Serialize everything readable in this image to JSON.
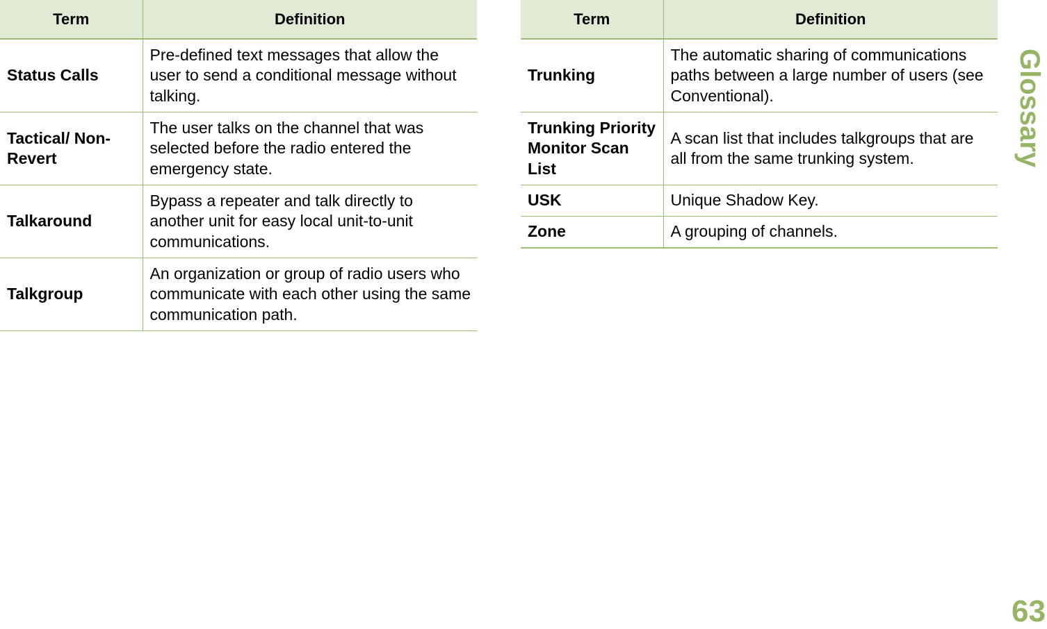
{
  "section_title": "Glossary",
  "page_number": "63",
  "accent_color": "#95b565",
  "header_bg_color": "#e1ead5",
  "tables": [
    {
      "headers": {
        "term": "Term",
        "definition": "Definition"
      },
      "rows": [
        {
          "term": "Status Calls",
          "definition": "Pre-defined text messages that allow the user to send a conditional message without talking."
        },
        {
          "term": "Tactical/ Non-Revert",
          "definition": "The user talks on the channel that was selected before the radio entered the emergency state."
        },
        {
          "term": "Talkaround",
          "definition": "Bypass a repeater and talk directly to another unit for easy local unit-to-unit communications."
        },
        {
          "term": "Talkgroup",
          "definition": "An organization or group of radio users who communicate with each other using the same communication path."
        }
      ]
    },
    {
      "headers": {
        "term": "Term",
        "definition": "Definition"
      },
      "rows": [
        {
          "term": "Trunking",
          "definition": "The automatic sharing of communications paths between a large number of users (see Conventional)."
        },
        {
          "term": "Trunking Priority Monitor Scan List",
          "definition": "A scan list that includes talkgroups that are all from the same trunking system."
        },
        {
          "term": "USK",
          "definition": "Unique Shadow Key."
        },
        {
          "term": "Zone",
          "definition": "A grouping of channels."
        }
      ]
    }
  ]
}
